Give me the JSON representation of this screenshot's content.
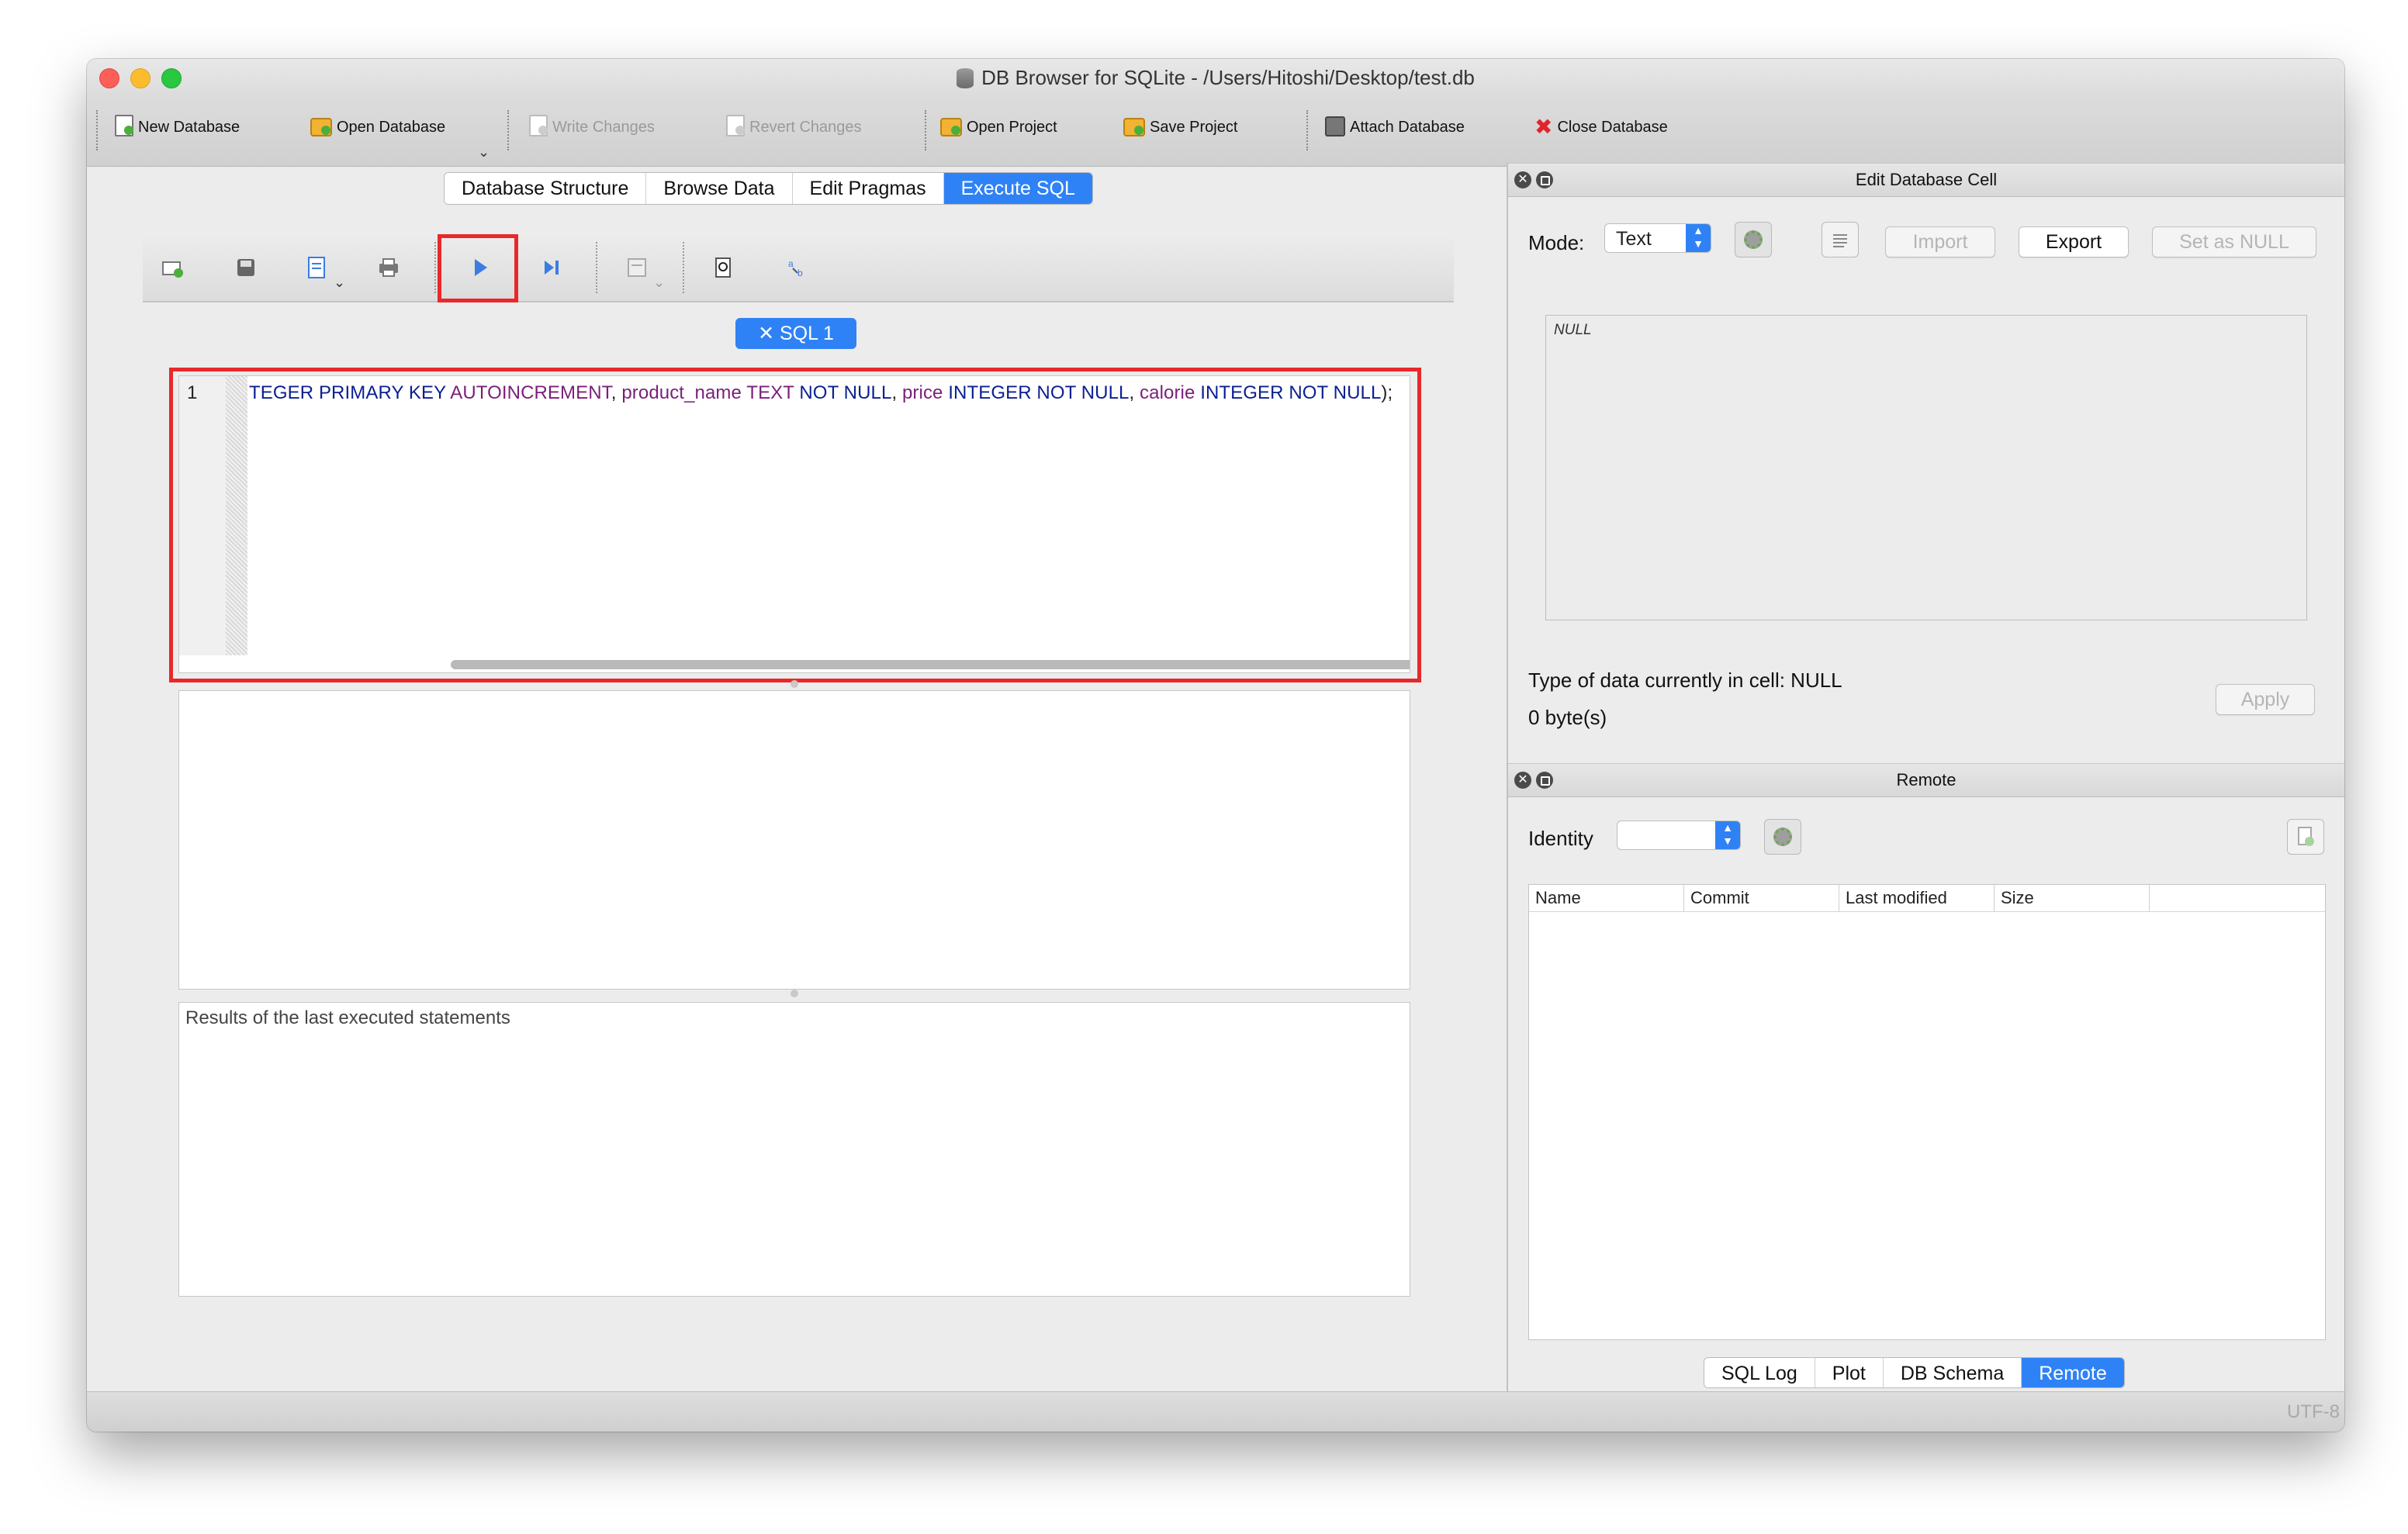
{
  "window": {
    "title": "DB Browser for SQLite - /Users/Hitoshi/Desktop/test.db"
  },
  "toolbar": {
    "new_database": "New Database",
    "open_database": "Open Database",
    "write_changes": "Write Changes",
    "revert_changes": "Revert Changes",
    "open_project": "Open Project",
    "save_project": "Save Project",
    "attach_database": "Attach Database",
    "close_database": "Close Database"
  },
  "main_tabs": [
    {
      "label": "Database Structure"
    },
    {
      "label": "Browse Data"
    },
    {
      "label": "Edit Pragmas"
    },
    {
      "label": "Execute SQL",
      "active": true
    }
  ],
  "sql_editor": {
    "tab_label": "✕  SQL 1",
    "line_number": "1",
    "code_tokens": [
      {
        "t": "TEGER PRIMARY KEY ",
        "c": "kw"
      },
      {
        "t": "AUTOINCREMENT",
        "c": "ident"
      },
      {
        "t": ", ",
        "c": "plain"
      },
      {
        "t": "product_name",
        "c": "ident"
      },
      {
        "t": " TEXT ",
        "c": "ident"
      },
      {
        "t": "NOT NULL",
        "c": "kw"
      },
      {
        "t": ", ",
        "c": "plain"
      },
      {
        "t": "price",
        "c": "ident"
      },
      {
        "t": " INTEGER NOT NULL",
        "c": "kw"
      },
      {
        "t": ", ",
        "c": "plain"
      },
      {
        "t": "calorie",
        "c": "ident"
      },
      {
        "t": " INTEGER NOT NULL",
        "c": "kw"
      },
      {
        "t": ");",
        "c": "plain"
      }
    ],
    "results_placeholder": "Results of the last executed statements"
  },
  "edit_cell": {
    "title": "Edit Database Cell",
    "mode_label": "Mode:",
    "mode_value": "Text",
    "import_label": "Import",
    "export_label": "Export",
    "set_null_label": "Set as NULL",
    "cell_value": "NULL",
    "type_info": "Type of data currently in cell: NULL",
    "size_info": "0 byte(s)",
    "apply_label": "Apply"
  },
  "remote": {
    "title": "Remote",
    "identity_label": "Identity",
    "identity_value": "",
    "columns": [
      "Name",
      "Commit",
      "Last modified",
      "Size"
    ]
  },
  "bottom_tabs": [
    {
      "label": "SQL Log"
    },
    {
      "label": "Plot"
    },
    {
      "label": "DB Schema"
    },
    {
      "label": "Remote",
      "active": true
    }
  ],
  "statusbar": {
    "encoding": "UTF-8"
  },
  "colors": {
    "accent": "#2f82f5",
    "highlight_red": "#e8282b",
    "sql_keyword": "#0b1f8f",
    "sql_identifier": "#7a1f7a"
  }
}
